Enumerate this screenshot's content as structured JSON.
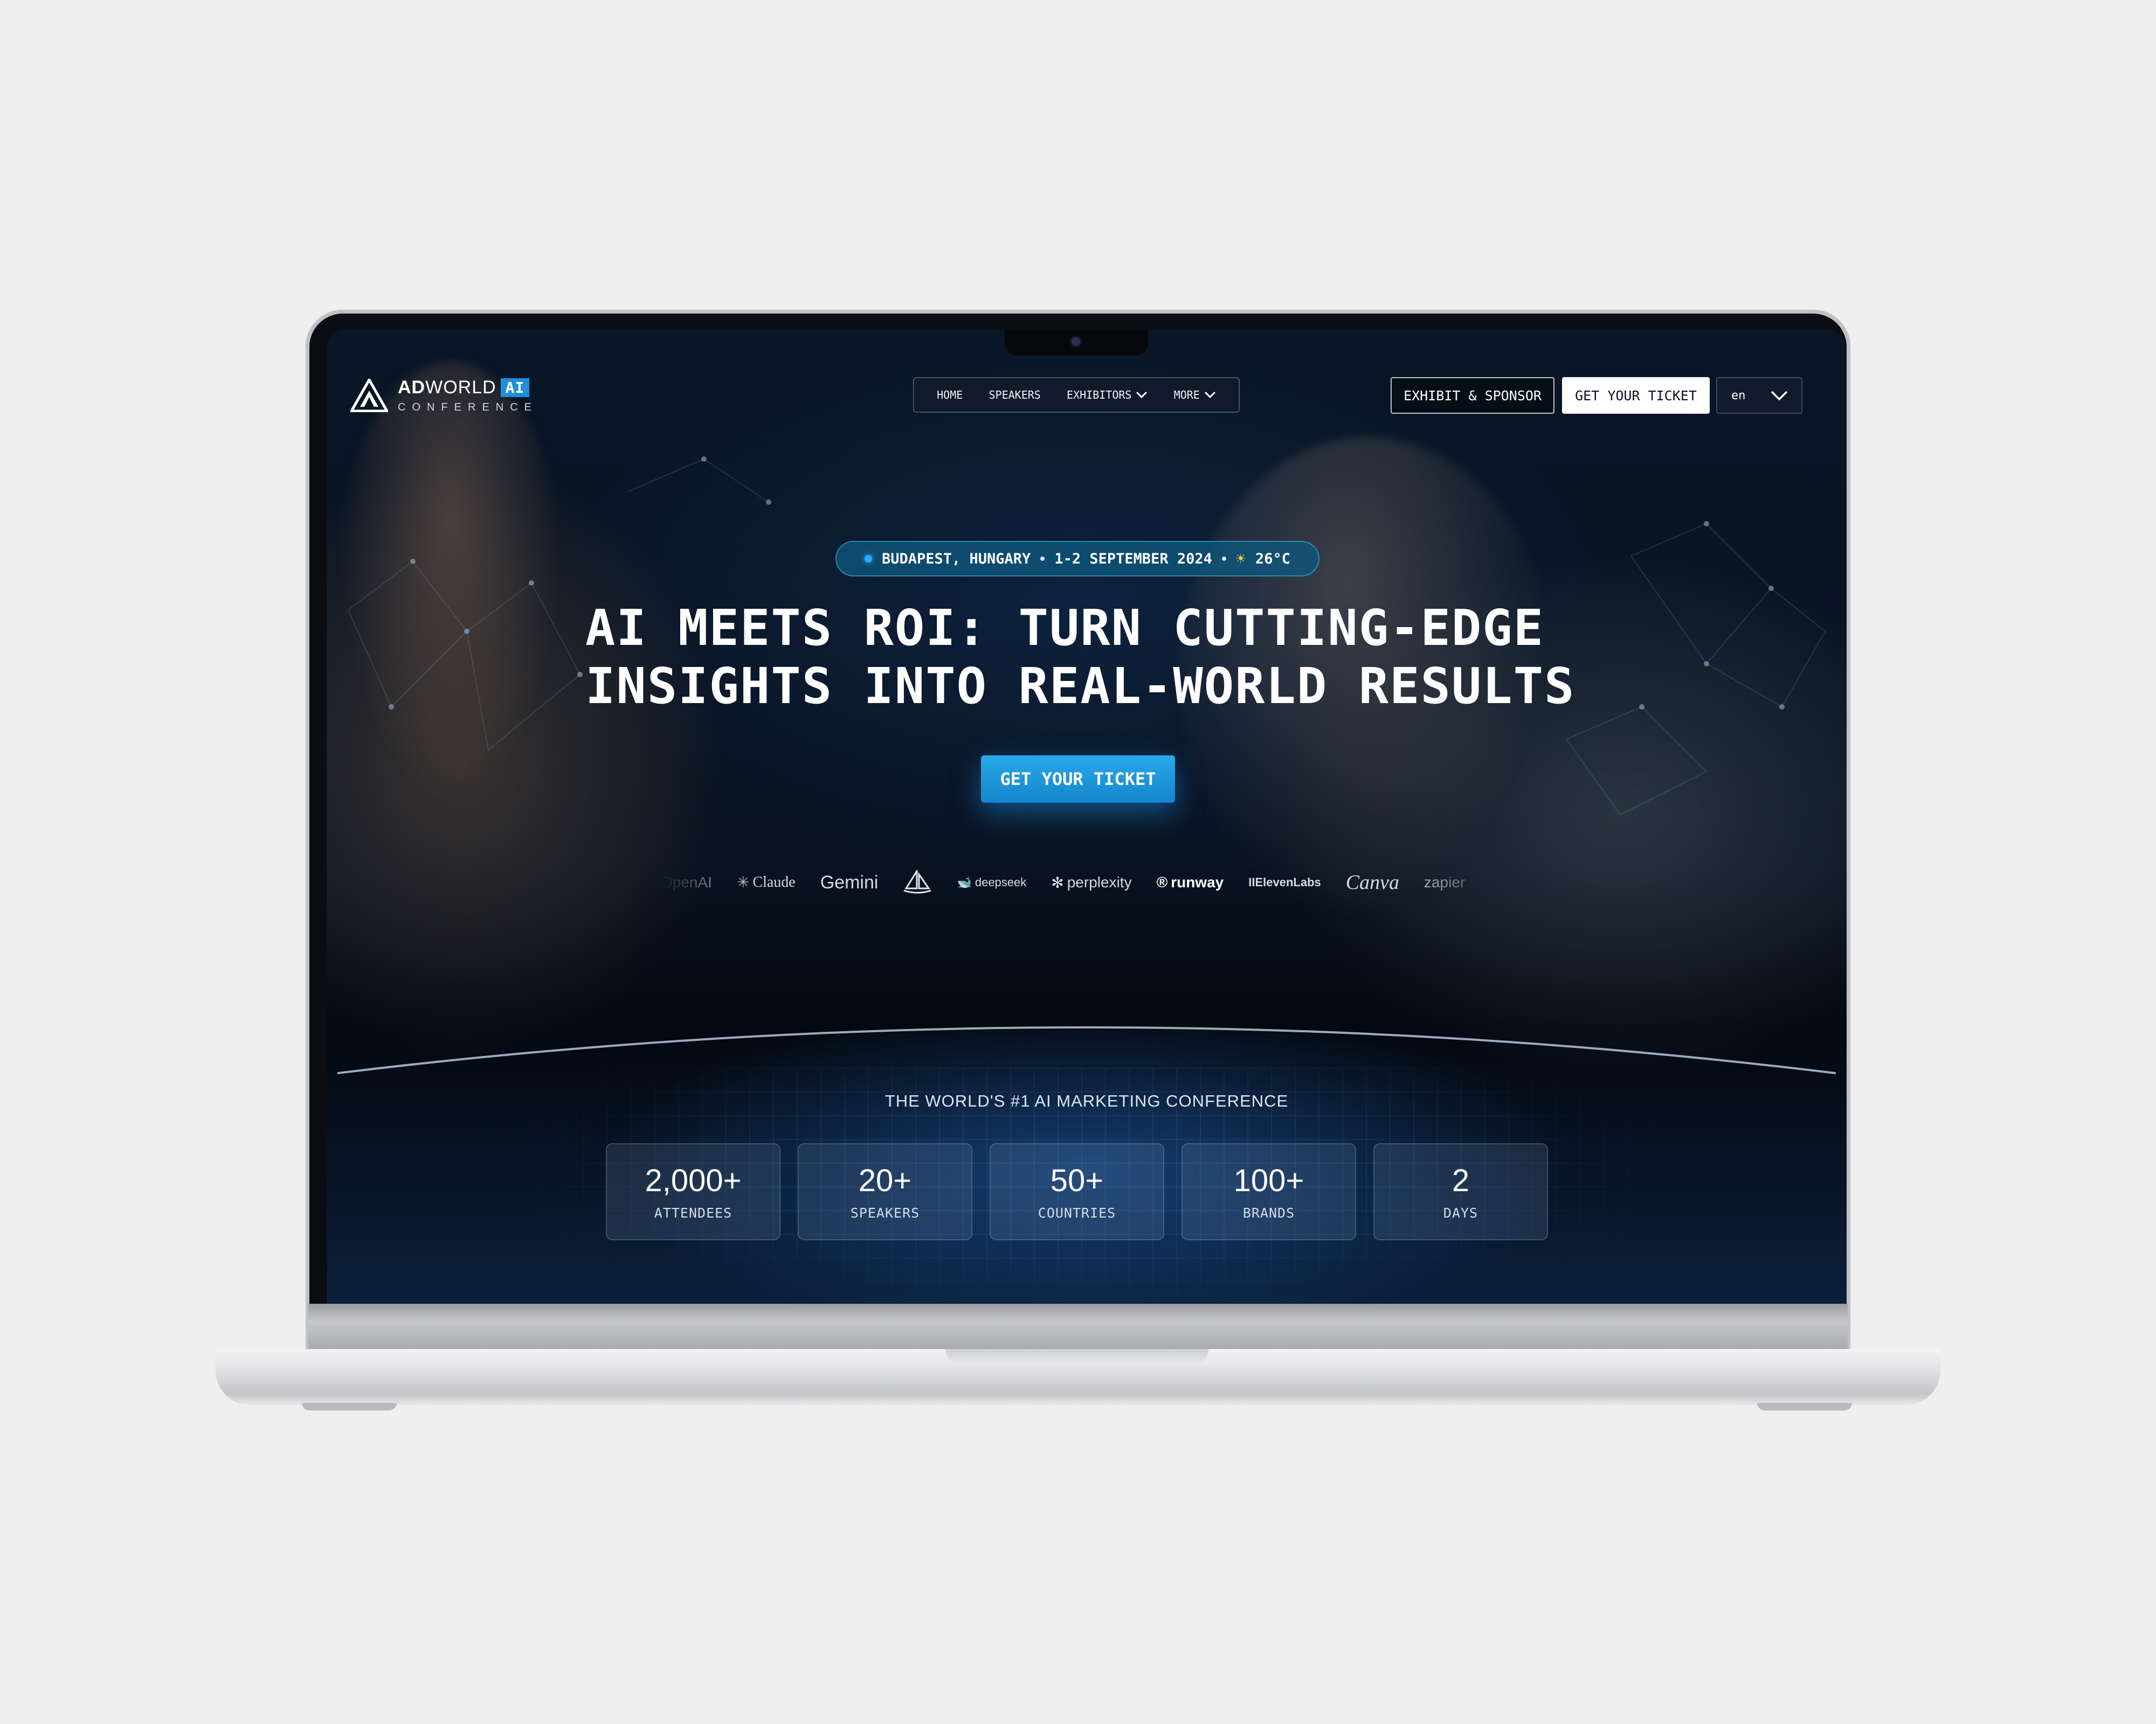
{
  "header": {
    "logo": {
      "brand_bold": "AD",
      "brand_rest": "WORLD",
      "badge": "AI",
      "sub": "CONFERENCE"
    },
    "nav": [
      {
        "label": "HOME",
        "has_dropdown": false
      },
      {
        "label": "SPEAKERS",
        "has_dropdown": false
      },
      {
        "label": "EXHIBITORS",
        "has_dropdown": true
      },
      {
        "label": "MORE",
        "has_dropdown": true
      }
    ],
    "exhibit_label": "EXHIBIT & SPONSOR",
    "ticket_label": "GET YOUR TICKET",
    "language": "en"
  },
  "hero": {
    "location": "BUDAPEST, HUNGARY",
    "dates": "1-2 SEPTEMBER 2024",
    "weather_icon": "sun-icon",
    "temperature": "26°C",
    "headline_line1": "AI MEETS ROI: TURN CUTTING-EDGE",
    "headline_line2": "INSIGHTS INTO REAL-WORLD RESULTS",
    "cta_label": "GET YOUR TICKET"
  },
  "brands": [
    "OpenAI",
    "Claude",
    "Gemini",
    "Midjourney",
    "deepseek",
    "perplexity",
    "runway",
    "IIElevenLabs",
    "Canva",
    "zapier"
  ],
  "stats_section": {
    "tagline": "THE WORLD'S #1 AI MARKETING CONFERENCE",
    "stats": [
      {
        "value": "2,000+",
        "label": "ATTENDEES"
      },
      {
        "value": "20+",
        "label": "SPEAKERS"
      },
      {
        "value": "50+",
        "label": "COUNTRIES"
      },
      {
        "value": "100+",
        "label": "BRANDS"
      },
      {
        "value": "2",
        "label": "DAYS"
      }
    ]
  },
  "colors": {
    "accent": "#1e8fd8",
    "cta": "#1a96dd",
    "background": "#0a1626",
    "page_bg": "#efefef"
  }
}
